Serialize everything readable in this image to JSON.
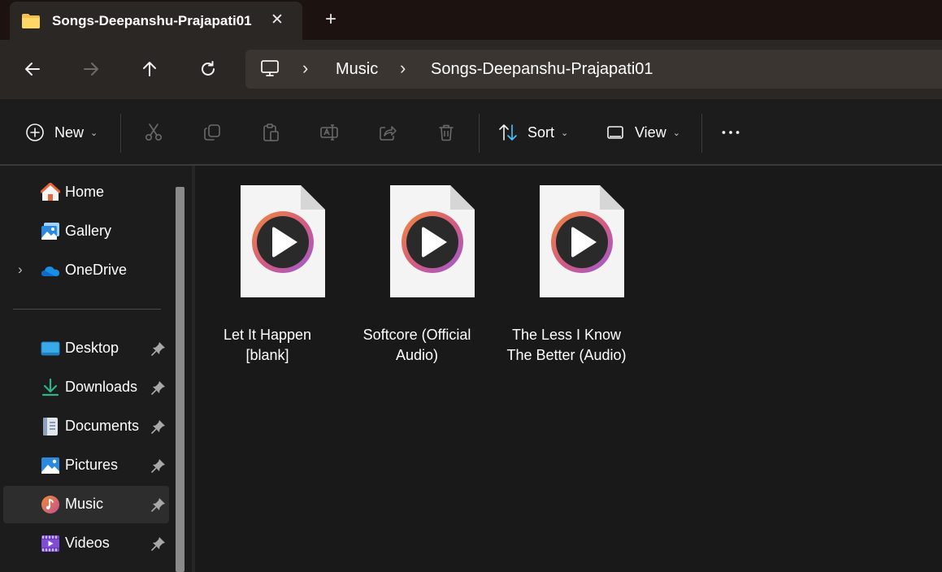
{
  "tab": {
    "title": "Songs-Deepanshu-Prajapati01",
    "close_glyph": "✕",
    "new_tab_glyph": "+"
  },
  "nav": {
    "back_icon": "arrow-left-icon",
    "forward_icon": "arrow-right-icon",
    "up_icon": "arrow-up-icon",
    "refresh_icon": "refresh-icon"
  },
  "address": {
    "root_icon": "this-pc-icon",
    "separator": "›",
    "crumbs": [
      "Music",
      "Songs-Deepanshu-Prajapati01"
    ]
  },
  "toolbar": {
    "new_label": "New",
    "sort_label": "Sort",
    "view_label": "View",
    "dropdown_glyph": "⌄",
    "icons": [
      "new-icon",
      "cut-icon",
      "copy-icon",
      "paste-icon",
      "rename-icon",
      "share-icon",
      "delete-icon",
      "sort-icon",
      "view-icon",
      "more-icon"
    ]
  },
  "sidebar": {
    "expand_glyph": "›",
    "items": [
      {
        "label": "Home",
        "icon": "home-icon",
        "pinned": false
      },
      {
        "label": "Gallery",
        "icon": "gallery-icon",
        "pinned": false
      },
      {
        "label": "OneDrive",
        "icon": "onedrive-icon",
        "pinned": false
      },
      {
        "label": "Desktop",
        "icon": "desktop-icon",
        "pinned": true
      },
      {
        "label": "Downloads",
        "icon": "downloads-icon",
        "pinned": true
      },
      {
        "label": "Documents",
        "icon": "documents-icon",
        "pinned": true
      },
      {
        "label": "Pictures",
        "icon": "pictures-icon",
        "pinned": true
      },
      {
        "label": "Music",
        "icon": "music-icon",
        "pinned": true,
        "selected": true
      },
      {
        "label": "Videos",
        "icon": "videos-icon",
        "pinned": true
      }
    ]
  },
  "files": [
    {
      "line1": "Let It Happen",
      "line2": "[blank]",
      "icon": "audio-file-icon"
    },
    {
      "line1": "Softcore (Official",
      "line2": "Audio)",
      "icon": "audio-file-icon"
    },
    {
      "line1": "The Less I Know",
      "line2": "The Better (Audio)",
      "icon": "audio-file-icon"
    }
  ],
  "colors": {
    "accent": "#4cc2ff",
    "tab_bg": "#2b2724",
    "window_bg": "#191919",
    "play_ring_start": "#f08a3a",
    "play_ring_end": "#9a5cd6"
  }
}
